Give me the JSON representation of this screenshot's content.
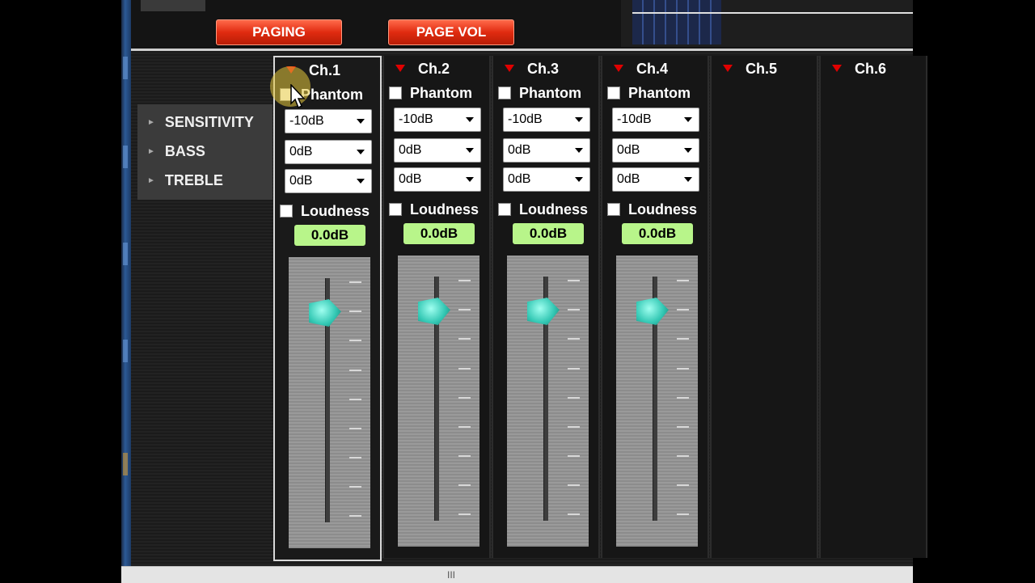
{
  "top_bar": {
    "paging_label": "PAGING",
    "page_vol_label": "PAGE VOL"
  },
  "params": {
    "sensitivity_label": "SENSITIVITY",
    "bass_label": "BASS",
    "treble_label": "TREBLE"
  },
  "channels": [
    {
      "name": "Ch.1",
      "phantom_label": "Phantom",
      "sensitivity": "-10dB",
      "bass": "0dB",
      "treble": "0dB",
      "loudness_label": "Loudness",
      "level": "0.0dB"
    },
    {
      "name": "Ch.2",
      "phantom_label": "Phantom",
      "sensitivity": "-10dB",
      "bass": "0dB",
      "treble": "0dB",
      "loudness_label": "Loudness",
      "level": "0.0dB"
    },
    {
      "name": "Ch.3",
      "phantom_label": "Phantom",
      "sensitivity": "-10dB",
      "bass": "0dB",
      "treble": "0dB",
      "loudness_label": "Loudness",
      "level": "0.0dB"
    },
    {
      "name": "Ch.4",
      "phantom_label": "Phantom",
      "sensitivity": "-10dB",
      "bass": "0dB",
      "treble": "0dB",
      "loudness_label": "Loudness",
      "level": "0.0dB"
    },
    {
      "name": "Ch.5"
    },
    {
      "name": "Ch.6"
    }
  ],
  "status_bar": {
    "grip": "III"
  },
  "colors": {
    "accent_red": "#e02b10",
    "level_green": "#b8f58a",
    "fader_knob": "#34c8b4"
  }
}
